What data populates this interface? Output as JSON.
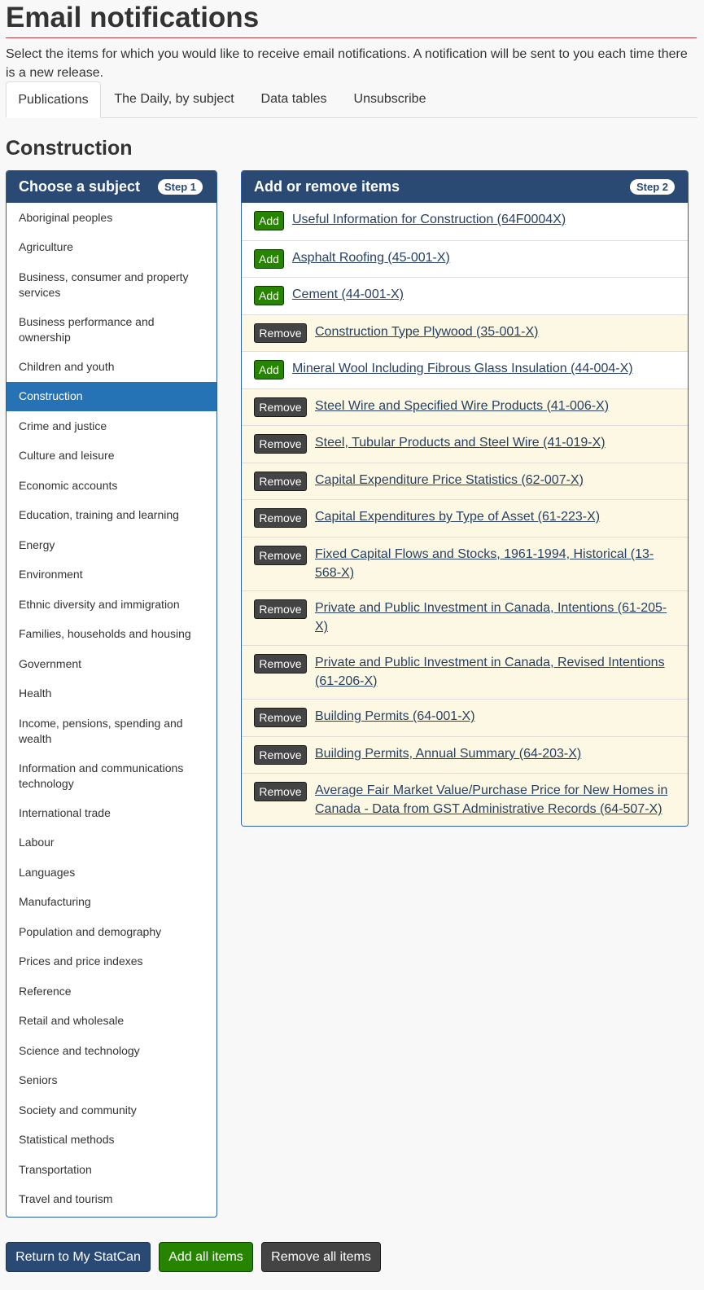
{
  "header": {
    "title": "Email notifications",
    "intro": "Select the items for which you would like to receive email notifications. A notification will be sent to you each time there is a new release."
  },
  "tabs": [
    {
      "label": "Publications",
      "active": true
    },
    {
      "label": "The Daily, by subject",
      "active": false
    },
    {
      "label": "Data tables",
      "active": false
    },
    {
      "label": "Unsubscribe",
      "active": false
    }
  ],
  "section_title": "Construction",
  "subjects_panel": {
    "title": "Choose a subject",
    "step": "Step 1",
    "items": [
      "Aboriginal peoples",
      "Agriculture",
      "Business, consumer and property services",
      "Business performance and ownership",
      "Children and youth",
      "Construction",
      "Crime and justice",
      "Culture and leisure",
      "Economic accounts",
      "Education, training and learning",
      "Energy",
      "Environment",
      "Ethnic diversity and immigration",
      "Families, households and housing",
      "Government",
      "Health",
      "Income, pensions, spending and wealth",
      "Information and communications technology",
      "International trade",
      "Labour",
      "Languages",
      "Manufacturing",
      "Population and demography",
      "Prices and price indexes",
      "Reference",
      "Retail and wholesale",
      "Science and technology",
      "Seniors",
      "Society and community",
      "Statistical methods",
      "Transportation",
      "Travel and tourism"
    ],
    "selected": "Construction"
  },
  "items_panel": {
    "title": "Add or remove items",
    "step": "Step 2",
    "add_label": "Add",
    "remove_label": "Remove",
    "items": [
      {
        "label": "Useful Information for Construction (64F0004X)",
        "action": "Add"
      },
      {
        "label": "Asphalt Roofing (45-001-X)",
        "action": "Add"
      },
      {
        "label": "Cement (44-001-X)",
        "action": "Add"
      },
      {
        "label": "Construction Type Plywood (35-001-X)",
        "action": "Remove"
      },
      {
        "label": "Mineral Wool Including Fibrous Glass Insulation (44-004-X)",
        "action": "Add"
      },
      {
        "label": "Steel Wire and Specified Wire Products (41-006-X)",
        "action": "Remove"
      },
      {
        "label": "Steel, Tubular Products and Steel Wire (41-019-X)",
        "action": "Remove"
      },
      {
        "label": "Capital Expenditure Price Statistics (62-007-X)",
        "action": "Remove"
      },
      {
        "label": "Capital Expenditures by Type of Asset (61-223-X)",
        "action": "Remove"
      },
      {
        "label": "Fixed Capital Flows and Stocks, 1961-1994, Historical (13-568-X)",
        "action": "Remove"
      },
      {
        "label": "Private and Public Investment in Canada, Intentions (61-205-X)",
        "action": "Remove"
      },
      {
        "label": "Private and Public Investment in Canada, Revised Intentions (61-206-X)",
        "action": "Remove"
      },
      {
        "label": "Building Permits (64-001-X)",
        "action": "Remove"
      },
      {
        "label": "Building Permits, Annual Summary (64-203-X)",
        "action": "Remove"
      },
      {
        "label": "Average Fair Market Value/Purchase Price for New Homes in Canada - Data from GST Administrative Records (64-507-X)",
        "action": "Remove"
      }
    ]
  },
  "footer_buttons": {
    "return": "Return to My StatCan",
    "add_all": "Add all items",
    "remove_all": "Remove all items"
  },
  "colors": {
    "header_blue": "#2a4a73",
    "active_subject": "#2572b4",
    "add_green": "#278400",
    "remove_dark": "#444444",
    "added_row_bg": "#fcf8e3",
    "title_rule": "#af3c43"
  }
}
